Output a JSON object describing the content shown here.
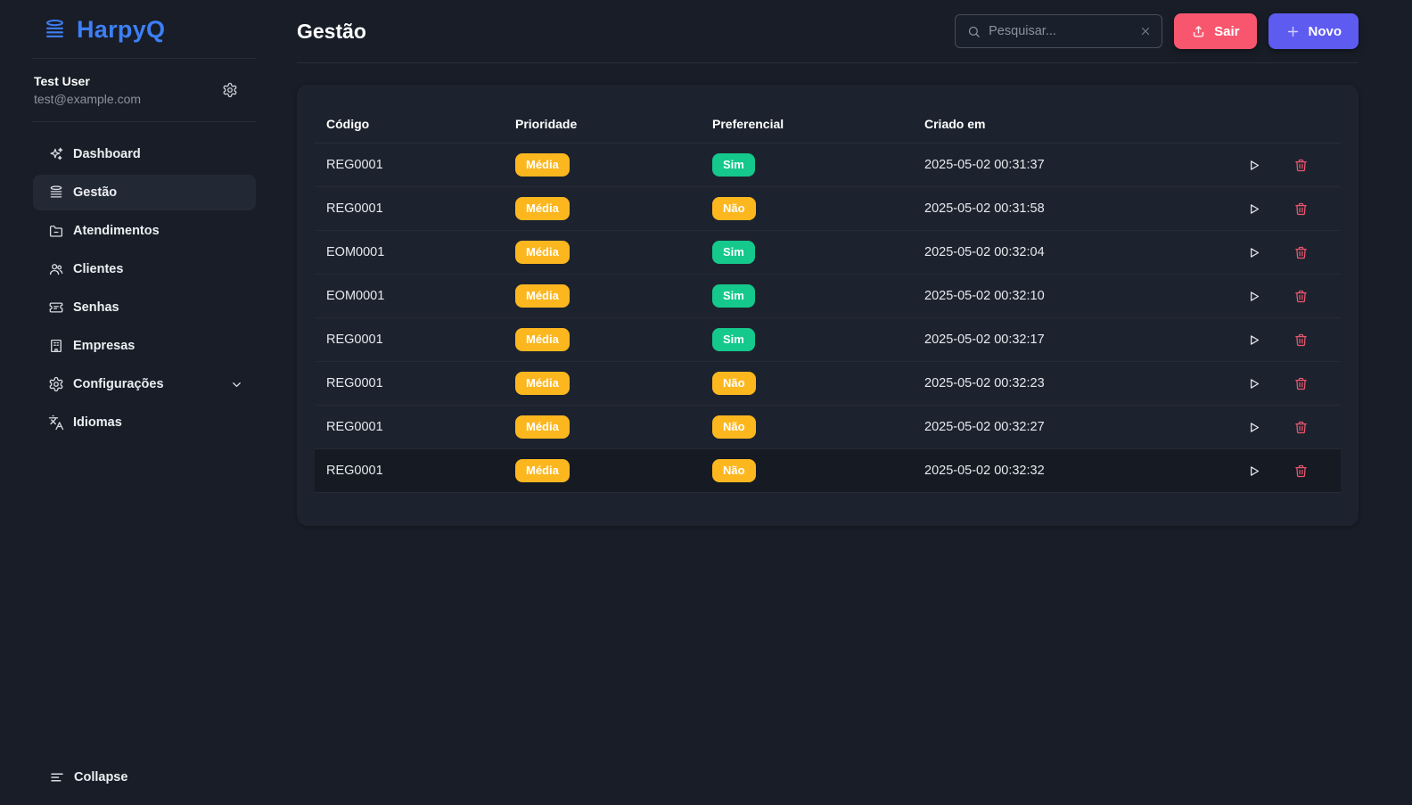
{
  "colors": {
    "accent_blue": "#3d7ff5",
    "danger_pink": "#f8566f",
    "primary_indigo": "#5d5bf0",
    "badge_amber": "#fcb71f",
    "badge_green": "#14c98b"
  },
  "sidebar": {
    "logo_text": "HarpyQ",
    "user": {
      "name": "Test User",
      "email": "test@example.com"
    },
    "items": [
      {
        "id": "dashboard",
        "label": "Dashboard",
        "icon": "sparkles"
      },
      {
        "id": "gestao",
        "label": "Gestão",
        "icon": "queue",
        "active": true
      },
      {
        "id": "atendimentos",
        "label": "Atendimentos",
        "icon": "folder-minus"
      },
      {
        "id": "clientes",
        "label": "Clientes",
        "icon": "users"
      },
      {
        "id": "senhas",
        "label": "Senhas",
        "icon": "ticket"
      },
      {
        "id": "empresas",
        "label": "Empresas",
        "icon": "building"
      },
      {
        "id": "configuracoes",
        "label": "Configurações",
        "icon": "gear",
        "expandable": true
      },
      {
        "id": "idiomas",
        "label": "Idiomas",
        "icon": "languages"
      }
    ],
    "collapse_label": "Collapse"
  },
  "header": {
    "title": "Gestão",
    "search_placeholder": "Pesquisar...",
    "logout_label": "Sair",
    "new_label": "Novo"
  },
  "table": {
    "columns": [
      "Código",
      "Prioridade",
      "Preferencial",
      "Criado em"
    ],
    "rows": [
      {
        "codigo": "REG0001",
        "prioridade": "Média",
        "preferencial": "Sim",
        "criado_em": "2025-05-02 00:31:37"
      },
      {
        "codigo": "REG0001",
        "prioridade": "Média",
        "preferencial": "Não",
        "criado_em": "2025-05-02 00:31:58"
      },
      {
        "codigo": "EOM0001",
        "prioridade": "Média",
        "preferencial": "Sim",
        "criado_em": "2025-05-02 00:32:04"
      },
      {
        "codigo": "EOM0001",
        "prioridade": "Média",
        "preferencial": "Sim",
        "criado_em": "2025-05-02 00:32:10"
      },
      {
        "codigo": "REG0001",
        "prioridade": "Média",
        "preferencial": "Sim",
        "criado_em": "2025-05-02 00:32:17"
      },
      {
        "codigo": "REG0001",
        "prioridade": "Média",
        "preferencial": "Não",
        "criado_em": "2025-05-02 00:32:23"
      },
      {
        "codigo": "REG0001",
        "prioridade": "Média",
        "preferencial": "Não",
        "criado_em": "2025-05-02 00:32:27"
      },
      {
        "codigo": "REG0001",
        "prioridade": "Média",
        "preferencial": "Não",
        "criado_em": "2025-05-02 00:32:32",
        "highlighted": true
      }
    ]
  }
}
